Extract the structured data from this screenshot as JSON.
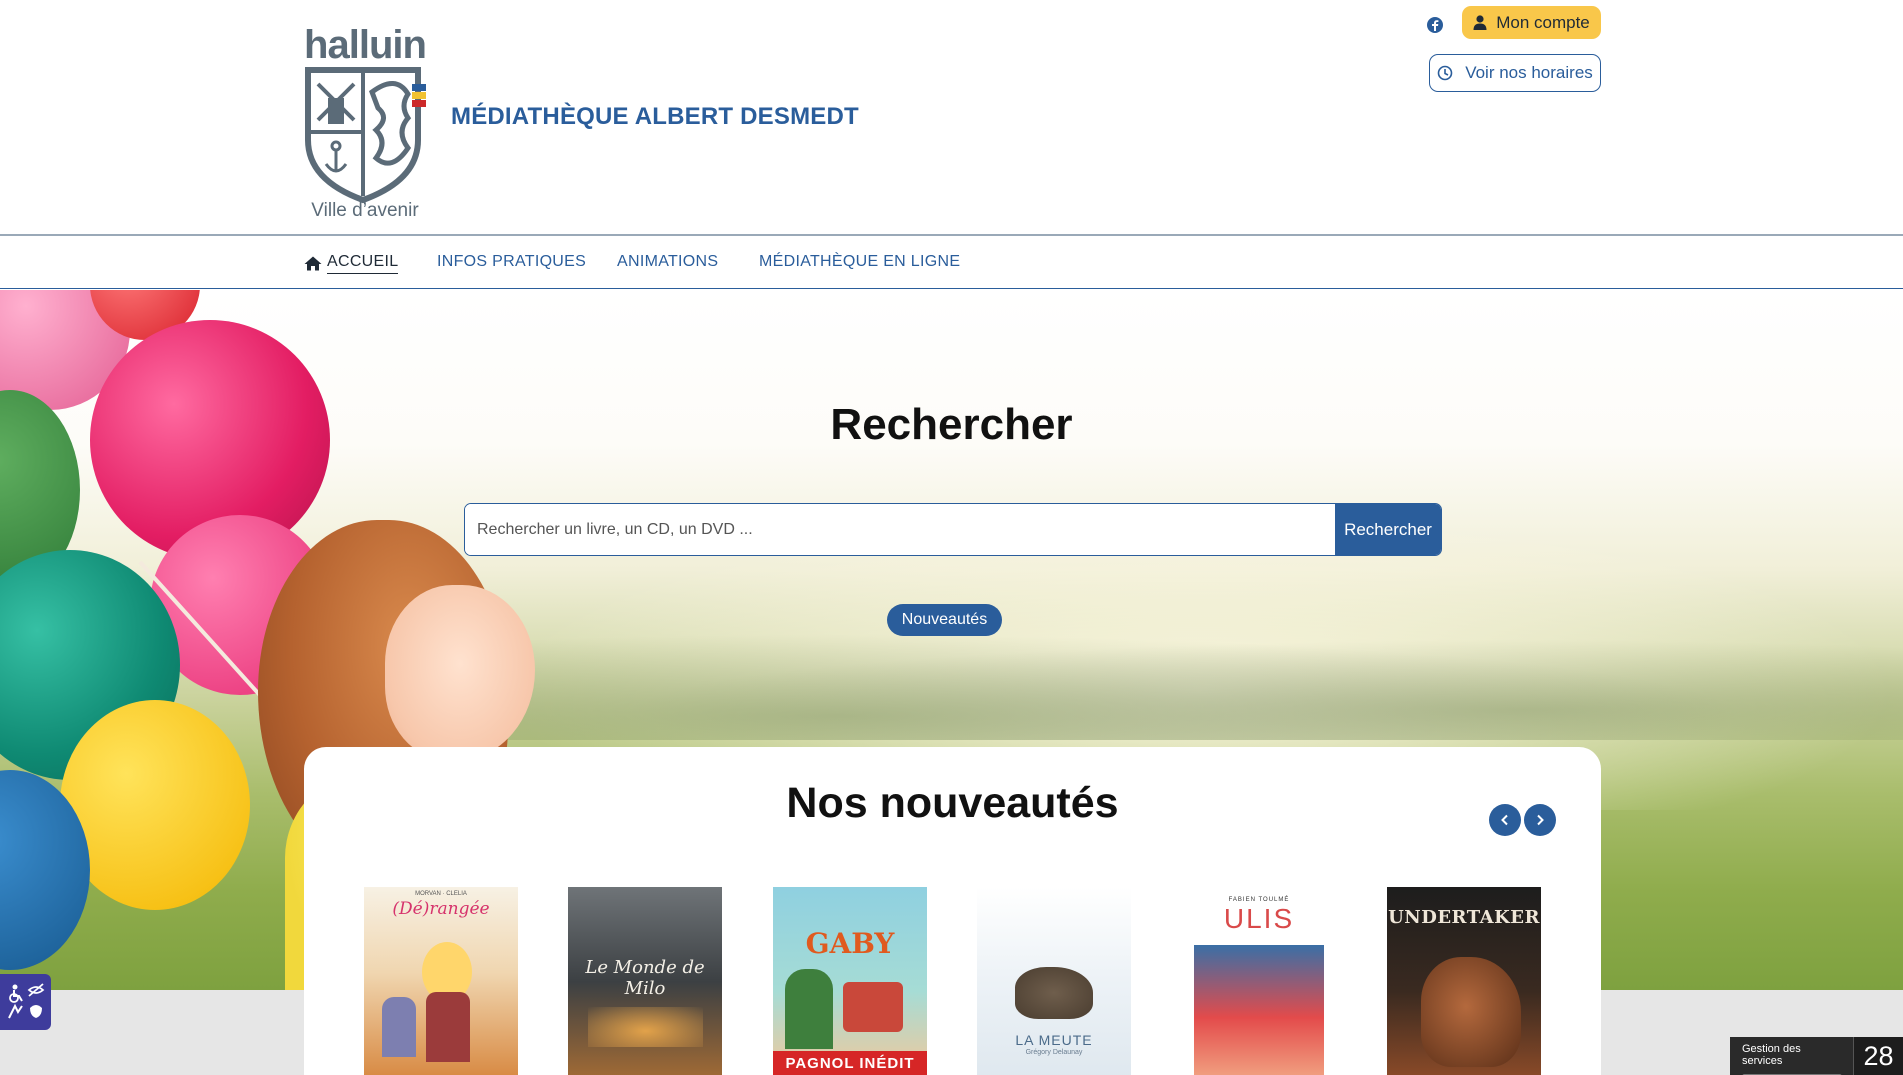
{
  "brand": {
    "logo_word": "halluin",
    "logo_tagline": "Ville d’avenir",
    "site_title": "MÉDIATHÈQUE ALBERT DESMEDT"
  },
  "header_actions": {
    "account_label": "Mon compte",
    "hours_label": "Voir nos horaires"
  },
  "nav": {
    "items": [
      {
        "label": "ACCUEIL"
      },
      {
        "label": "INFOS PRATIQUES"
      },
      {
        "label": "ANIMATIONS"
      },
      {
        "label": "MÉDIATHÈQUE EN LIGNE"
      }
    ]
  },
  "search": {
    "title": "Rechercher",
    "placeholder": "Rechercher un livre, un CD, un DVD ...",
    "button_label": "Rechercher",
    "news_pill": "Nouveautés"
  },
  "new_releases": {
    "title": "Nos nouveautés",
    "covers": [
      {
        "title": "(Dé)rangée",
        "author": "MORVAN · CLELIA"
      },
      {
        "title": "Le Monde de Milo",
        "author": ""
      },
      {
        "title": "GABY",
        "banner": "PAGNOL INÉDIT"
      },
      {
        "title": "LA MEUTE",
        "author": "Grégory Delaunay"
      },
      {
        "title": "ULIS",
        "author": "FABIEN TOULMÉ"
      },
      {
        "title": "UNDERTAKER",
        "author": ""
      }
    ]
  },
  "cookie": {
    "label": "Gestion des services",
    "count": "28"
  },
  "colors": {
    "primary": "#2a5d9b",
    "accent": "#f9c74a",
    "logo_gray": "#5b6b78"
  },
  "icons": {
    "facebook": "facebook-icon",
    "account": "user-icon",
    "hours": "clock-icon",
    "home": "home-icon",
    "prev": "chevron-left-icon",
    "next": "chevron-right-icon",
    "accessibility": "accessibility-icon"
  }
}
